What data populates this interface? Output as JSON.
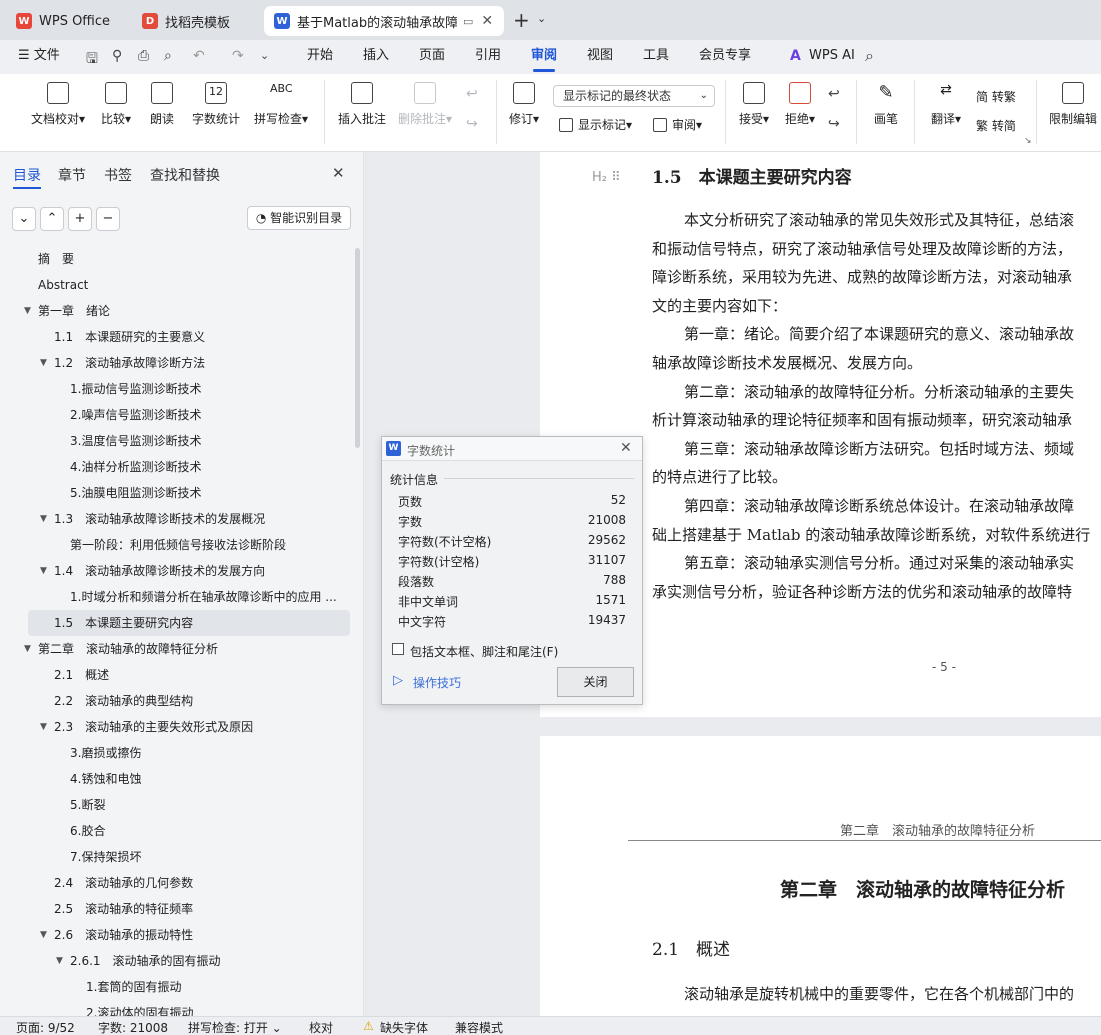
{
  "tabs": [
    {
      "label": "WPS Office"
    },
    {
      "label": "找稻壳模板"
    },
    {
      "label": "基于Matlab的滚动轴承故障诊"
    }
  ],
  "menu": {
    "file": "文件",
    "items": [
      "开始",
      "插入",
      "页面",
      "引用",
      "审阅",
      "视图",
      "工具",
      "会员专享"
    ],
    "active": "审阅",
    "wps_ai": "WPS AI"
  },
  "ribbon": {
    "doc_check": "文档校对",
    "compare": "比较",
    "read": "朗读",
    "word_count": "字数统计",
    "spell_check": "拼写检查",
    "insert_comment": "插入批注",
    "delete_comment": "删除批注",
    "revise": "修订",
    "markup_dropdown": "显示标记的最终状态",
    "show_markup": "显示标记",
    "review": "审阅",
    "accept": "接受",
    "reject": "拒绝",
    "pen": "画笔",
    "translate": "翻译",
    "to_trad": "简 转繁",
    "to_simp": "繁 转简",
    "restrict": "限制编辑",
    "wc_icon_text": "12",
    "abc": "ABC"
  },
  "sidebar": {
    "tabs": [
      "目录",
      "章节",
      "书签",
      "查找和替换"
    ],
    "smart_btn": "智能识别目录",
    "toc": [
      {
        "t": "摘　要"
      },
      {
        "t": "Abstract"
      },
      {
        "t": "第一章　绪论"
      },
      {
        "t": "1.1　本课题研究的主要意义"
      },
      {
        "t": "1.2　滚动轴承故障诊断方法"
      },
      {
        "t": "1.振动信号监测诊断技术"
      },
      {
        "t": "2.噪声信号监测诊断技术"
      },
      {
        "t": "3.温度信号监测诊断技术"
      },
      {
        "t": "4.油样分析监测诊断技术"
      },
      {
        "t": "5.油膜电阻监测诊断技术"
      },
      {
        "t": "1.3　滚动轴承故障诊断技术的发展概况"
      },
      {
        "t": "第一阶段：利用低频信号接收法诊断阶段"
      },
      {
        "t": "1.4　滚动轴承故障诊断技术的发展方向"
      },
      {
        "t": "1.时域分析和频谱分析在轴承故障诊断中的应用 ..."
      },
      {
        "t": "1.5　本课题主要研究内容"
      },
      {
        "t": "第二章　滚动轴承的故障特征分析"
      },
      {
        "t": "2.1　概述"
      },
      {
        "t": "2.2　滚动轴承的典型结构"
      },
      {
        "t": "2.3　滚动轴承的主要失效形式及原因"
      },
      {
        "t": "3.磨损或擦伤"
      },
      {
        "t": "4.锈蚀和电蚀"
      },
      {
        "t": "5.断裂"
      },
      {
        "t": "6.胶合"
      },
      {
        "t": "7.保持架损坏"
      },
      {
        "t": "2.4　滚动轴承的几何参数"
      },
      {
        "t": "2.5　滚动轴承的特征频率"
      },
      {
        "t": "2.6　滚动轴承的振动特性"
      },
      {
        "t": "2.6.1　滚动轴承的固有振动"
      },
      {
        "t": "1.套筒的固有振动"
      },
      {
        "t": "2.滚动体的固有振动"
      }
    ]
  },
  "doc": {
    "heading_marker": "H₂",
    "heading": "1.5　本课题主要研究内容",
    "lines": [
      "本文分析研究了滚动轴承的常见失效形式及其特征，总结滚",
      "和振动信号特点，研究了滚动轴承信号处理及故障诊断的方法，",
      "障诊断系统，采用较为先进、成熟的故障诊断方法，对滚动轴承",
      "文的主要内容如下：",
      "第一章：绪论。简要介绍了本课题研究的意义、滚动轴承故",
      "轴承故障诊断技术发展概况、发展方向。",
      "第二章：滚动轴承的故障特征分析。分析滚动轴承的主要失",
      "析计算滚动轴承的理论特征频率和固有振动频率，研究滚动轴承",
      "第三章：滚动轴承故障诊断方法研究。包括时域方法、频域",
      "的特点进行了比较。",
      "第四章：滚动轴承故障诊断系统总体设计。在滚动轴承故障",
      "础上搭建基于 Matlab 的滚动轴承故障诊断系统，对软件系统进行",
      "第五章：滚动轴承实测信号分析。通过对采集的滚动轴承实",
      "承实测信号分析，验证各种诊断方法的优劣和滚动轴承的故障特"
    ],
    "page_num": "- 5 -",
    "header2": "第二章　滚动轴承的故障特征分析",
    "chapter_title": "第二章　滚动轴承的故障特征分析",
    "section": "2.1　概述",
    "p2_line": "滚动轴承是旋转机械中的重要零件，它在各个机械部门中的"
  },
  "dialog": {
    "title": "字数统计",
    "group": "统计信息",
    "rows": [
      {
        "k": "页数",
        "v": "52"
      },
      {
        "k": "字数",
        "v": "21008"
      },
      {
        "k": "字符数(不计空格)",
        "v": "29562"
      },
      {
        "k": "字符数(计空格)",
        "v": "31107"
      },
      {
        "k": "段落数",
        "v": "788"
      },
      {
        "k": "非中文单词",
        "v": "1571"
      },
      {
        "k": "中文字符",
        "v": "19437"
      }
    ],
    "checkbox": "包括文本框、脚注和尾注(F)",
    "tips": "操作技巧",
    "close": "关闭"
  },
  "status": {
    "page": "页面: 9/52",
    "words": "字数: 21008",
    "spell": "拼写检查: 打开",
    "proof": "校对",
    "missing_font": "缺失字体",
    "compat": "兼容模式"
  },
  "colors": {
    "accent": "#1f57d6",
    "wps_red": "#e8463a"
  }
}
